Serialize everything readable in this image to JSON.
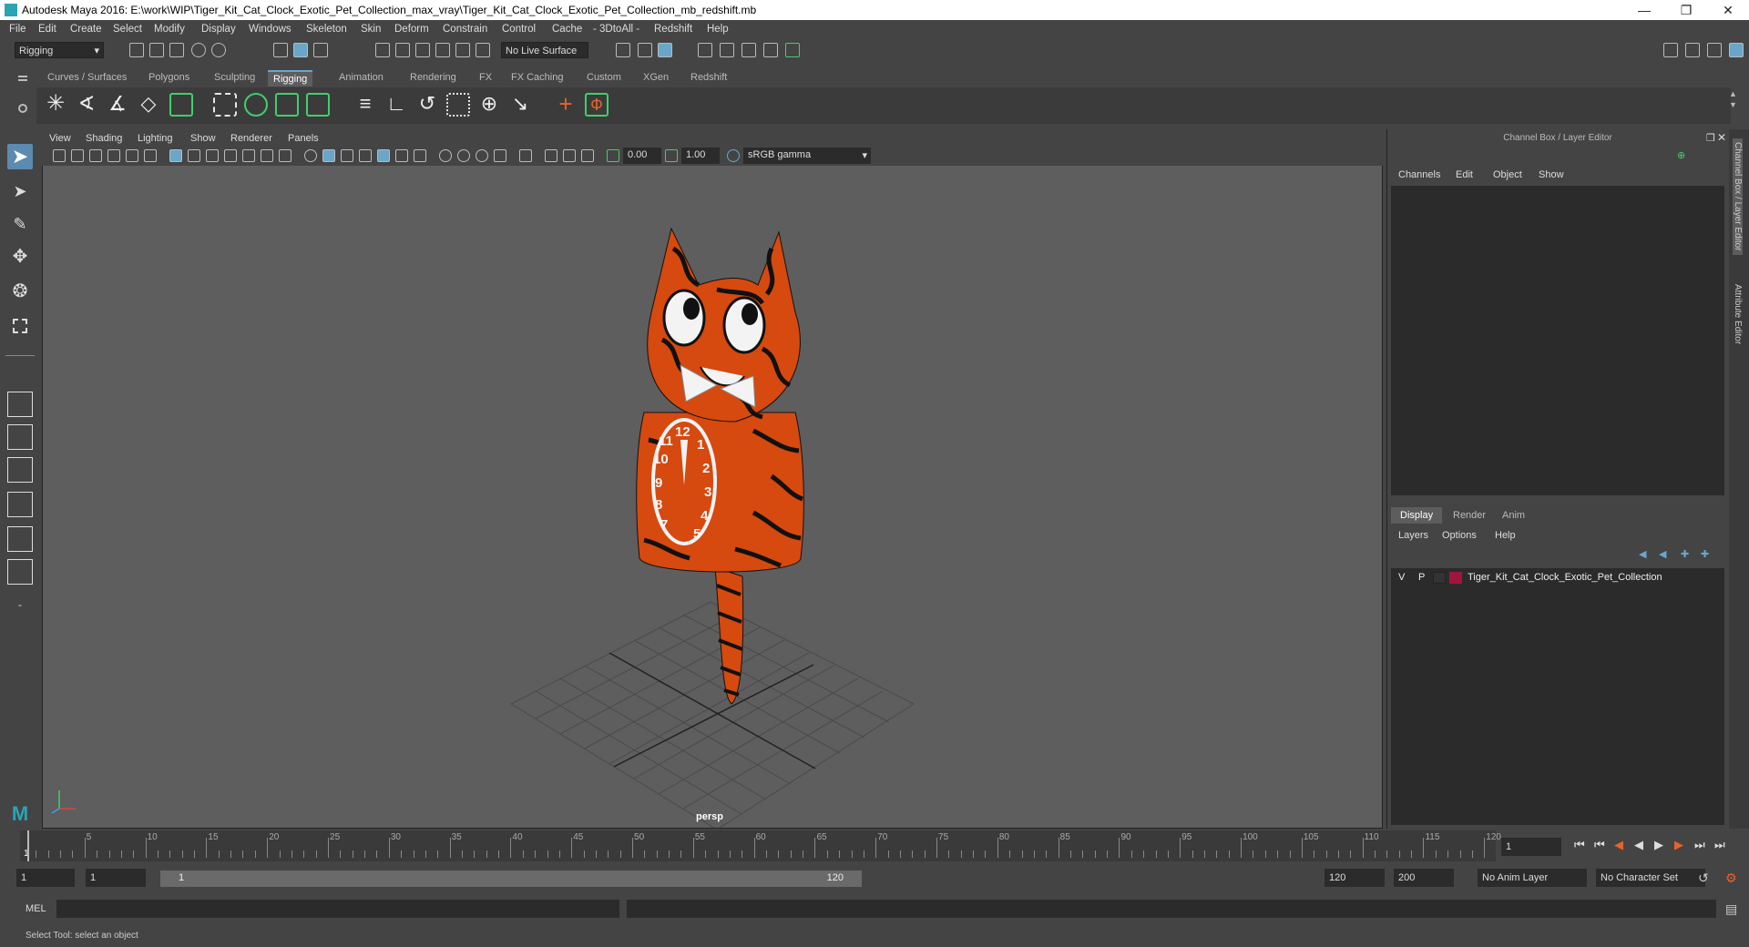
{
  "title": "Autodesk Maya 2016: E:\\work\\WIP\\Tiger_Kit_Cat_Clock_Exotic_Pet_Collection_max_vray\\Tiger_Kit_Cat_Clock_Exotic_Pet_Collection_mb_redshift.mb",
  "menu": [
    "File",
    "Edit",
    "Create",
    "Select",
    "Modify",
    "Display",
    "Windows",
    "Skeleton",
    "Skin",
    "Deform",
    "Constrain",
    "Control",
    "Cache",
    "- 3DtoAll -",
    "Redshift",
    "Help"
  ],
  "status": {
    "mode": "Rigging",
    "live_surface": "No Live Surface"
  },
  "shelf_tabs": [
    "Curves / Surfaces",
    "Polygons",
    "Sculpting",
    "Rigging",
    "Animation",
    "Rendering",
    "FX",
    "FX Caching",
    "Custom",
    "XGen",
    "Redshift"
  ],
  "active_shelf": "Rigging",
  "viewport": {
    "menu": [
      "View",
      "Shading",
      "Lighting",
      "Show",
      "Renderer",
      "Panels"
    ],
    "exposure": "0.00",
    "gamma": "1.00",
    "colorspace": "sRGB gamma",
    "camera_label": "persp"
  },
  "channel_box": {
    "title": "Channel Box / Layer Editor",
    "menu": [
      "Channels",
      "Edit",
      "Object",
      "Show"
    ],
    "layer_tabs": [
      "Display",
      "Render",
      "Anim"
    ],
    "layer_menu": [
      "Layers",
      "Options",
      "Help"
    ],
    "layer": {
      "v": "V",
      "p": "P",
      "name": "Tiger_Kit_Cat_Clock_Exotic_Pet_Collection",
      "color": "#a0153e"
    }
  },
  "side_tabs": [
    "Channel Box / Layer Editor",
    "Attribute Editor"
  ],
  "timeline": {
    "ticks": [
      "5",
      "10",
      "15",
      "20",
      "25",
      "30",
      "35",
      "40",
      "45",
      "50",
      "55",
      "60",
      "65",
      "70",
      "75",
      "80",
      "85",
      "90",
      "95",
      "100",
      "105",
      "110",
      "115",
      "120"
    ],
    "start_label": "1",
    "current_frame": "1"
  },
  "range": {
    "start": "1",
    "start2": "1",
    "slider_start": "1",
    "slider_end": "120",
    "end": "120",
    "end2": "200",
    "anim_layer": "No Anim Layer",
    "char_set": "No Character Set"
  },
  "cmd": {
    "label": "MEL"
  },
  "help_line": "Select Tool: select an object",
  "colors": {
    "accent": "#6aa6c9",
    "tiger_orange": "#d6490f",
    "shelf_green": "#3fd06a"
  }
}
